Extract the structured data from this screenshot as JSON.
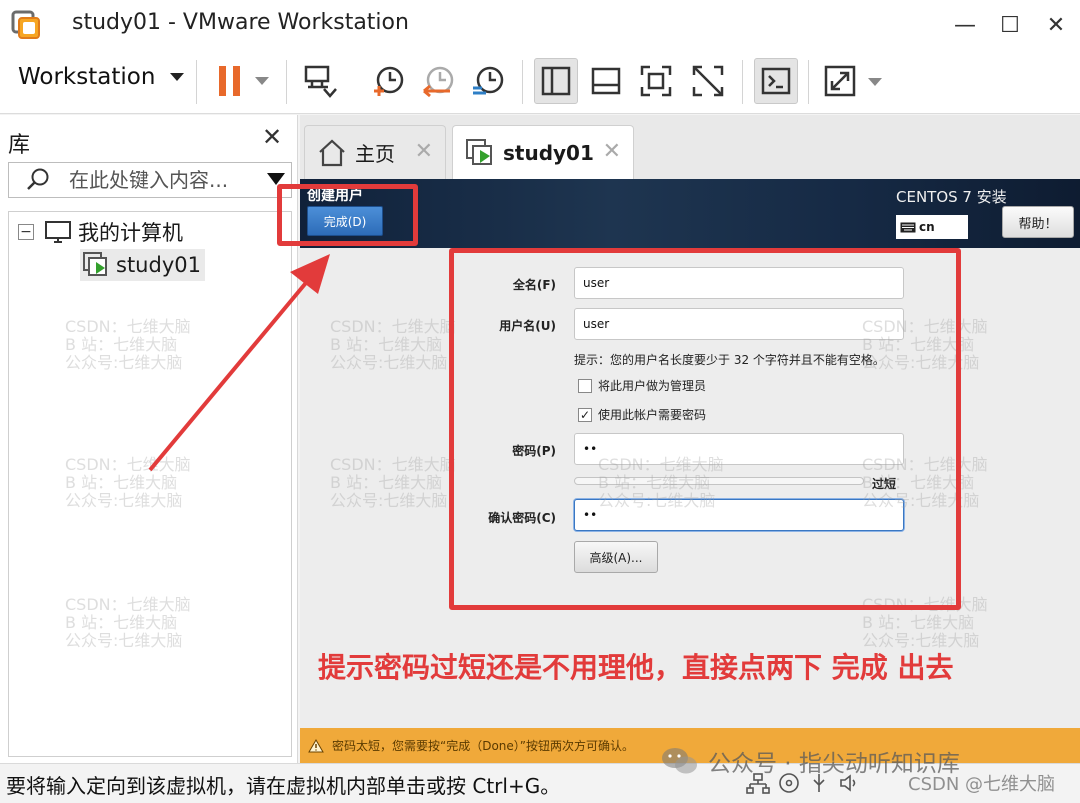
{
  "window": {
    "title": "study01 - VMware Workstation",
    "minimize_glyph": "—",
    "maximize_glyph": "☐",
    "close_glyph": "✕"
  },
  "toolbar": {
    "menu_label": "Workstation",
    "icons": [
      "pause-icon",
      "send-ctrl-alt-del-icon",
      "snapshot-take-icon",
      "snapshot-revert-icon",
      "snapshot-manager-icon",
      "view-sidebar-icon",
      "view-thumbnail-icon",
      "fullscreen-icon",
      "unity-icon",
      "console-icon",
      "stretch-icon"
    ],
    "accent_color": "#e8692b"
  },
  "library": {
    "title": "库",
    "search_placeholder": "在此处键入内容...",
    "tree": {
      "root_label": "我的计算机",
      "root_toggle": "−",
      "child_label": "study01"
    }
  },
  "tabs": [
    {
      "label": "主页",
      "icon": "home-icon"
    },
    {
      "label": "study01",
      "icon": "vm-icon"
    }
  ],
  "vm": {
    "header_title": "创建用户",
    "done_label": "完成(D)",
    "installer_title": "CENTOS 7 安装",
    "keyboard_layout": "cn",
    "help_label": "帮助！",
    "form": {
      "fullname_label": "全名(F)",
      "fullname_value": "user",
      "username_label": "用户名(U)",
      "username_value": "user",
      "hint": "提示：您的用户名长度要少于 32 个字符并且不能有空格。",
      "admin_checkbox_label": "将此用户做为管理员",
      "admin_checked": false,
      "require_password_label": "使用此帐户需要密码",
      "require_password_checked": true,
      "password_label": "密码(P)",
      "password_value": "••",
      "strength_label": "过短",
      "strength_level": 0,
      "confirm_label": "确认密码(C)",
      "confirm_value": "••",
      "advanced_label": "高级(A)..."
    },
    "warning": "密码太短，您需要按“完成（Done）”按钮两次方可确认。"
  },
  "annotation": {
    "text": "提示密码过短还是不用理他，直接点两下 完成 出去",
    "color": "#e23b3b"
  },
  "watermark": {
    "line1": "CSDN：七维大脑",
    "line2": "B 站：七维大脑",
    "line3": "公众号:七维大脑"
  },
  "status": {
    "text": "要将输入定向到该虚拟机，请在虚拟机内部单击或按 Ctrl+G。"
  },
  "overlay_marks": {
    "wechat": "公众号 · 指尖动听知识库",
    "csdn": "CSDN @七维大脑"
  }
}
